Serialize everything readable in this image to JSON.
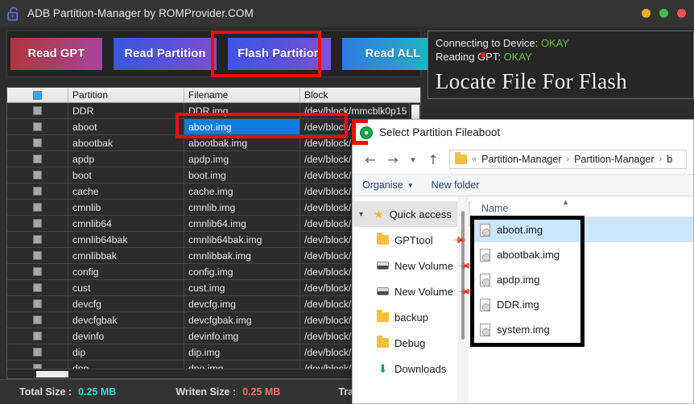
{
  "app": {
    "title": "ADB Partition-Manager by ROMProvider.COM",
    "lock_icon": "unlock-icon",
    "window_controls": [
      {
        "name": "minimize",
        "color": "#eeb020"
      },
      {
        "name": "maximize",
        "color": "#3fbf4e"
      },
      {
        "name": "close",
        "color": "#ef5350"
      }
    ]
  },
  "toolbar": {
    "buttons": [
      {
        "label": "Read GPT",
        "name": "read-gpt-button"
      },
      {
        "label": "Read Partition",
        "name": "read-partition-button"
      },
      {
        "label": "Flash  Partition",
        "name": "flash-partition-button",
        "highlighted": true
      },
      {
        "label": "Read ALL",
        "name": "read-all-button"
      }
    ]
  },
  "table": {
    "headers": [
      "",
      "Partition",
      "Filename",
      "Block"
    ],
    "select_all_checked": true,
    "rows": [
      {
        "partition": "DDR",
        "filename": "DDR.img",
        "block": "/dev/block/mmcblk0p15",
        "selected": false
      },
      {
        "partition": "aboot",
        "filename": "aboot.img",
        "block": "/dev/block/m",
        "selected": true
      },
      {
        "partition": "abootbak",
        "filename": "abootbak.img",
        "block": "/dev/block/m",
        "selected": false
      },
      {
        "partition": "apdp",
        "filename": "apdp.img",
        "block": "/dev/block/m",
        "selected": false
      },
      {
        "partition": "boot",
        "filename": "boot.img",
        "block": "/dev/block/m",
        "selected": false
      },
      {
        "partition": "cache",
        "filename": "cache.img",
        "block": "/dev/block/m",
        "selected": false
      },
      {
        "partition": "cmnlib",
        "filename": "cmnlib.img",
        "block": "/dev/block/m",
        "selected": false
      },
      {
        "partition": "cmnlib64",
        "filename": "cmnlib64.img",
        "block": "/dev/block/m",
        "selected": false
      },
      {
        "partition": "cmnlib64bak",
        "filename": "cmnlib64bak.img",
        "block": "/dev/block/m",
        "selected": false
      },
      {
        "partition": "cmnlibbak",
        "filename": "cmnlibbak.img",
        "block": "/dev/block/m",
        "selected": false
      },
      {
        "partition": "config",
        "filename": "config.img",
        "block": "/dev/block/m",
        "selected": false
      },
      {
        "partition": "cust",
        "filename": "cust.img",
        "block": "/dev/block/m",
        "selected": false
      },
      {
        "partition": "devcfg",
        "filename": "devcfg.img",
        "block": "/dev/block/m",
        "selected": false
      },
      {
        "partition": "devcfgbak",
        "filename": "devcfgbak.img",
        "block": "/dev/block/m",
        "selected": false
      },
      {
        "partition": "devinfo",
        "filename": "devinfo.img",
        "block": "/dev/block/m",
        "selected": false
      },
      {
        "partition": "dip",
        "filename": "dip.img",
        "block": "/dev/block/m",
        "selected": false
      },
      {
        "partition": "dpo",
        "filename": "dpo.img",
        "block": "/dev/block/m",
        "selected": false
      }
    ]
  },
  "status_panel": {
    "line1_label": "Connecting to Device:",
    "line1_value": "OKAY",
    "line2_label": "Reading GPT:",
    "line2_value": "OKAY",
    "heading": "Locate File For Flash"
  },
  "statusbar": {
    "total_size_label": "Total Size :",
    "total_size_value": "0.25 MB",
    "written_size_label": "Writen Size :",
    "written_size_value": "0.25 MB",
    "transfer_label": "Transfe"
  },
  "dialog": {
    "title": "Select Partition Fileaboot",
    "nav": {
      "back_icon": "arrow-left-icon",
      "forward_icon": "arrow-right-icon",
      "recent_icon": "chevron-down-icon",
      "up_icon": "arrow-up-icon"
    },
    "breadcrumb": [
      "«",
      "Partition-Manager",
      "Partition-Manager",
      "b"
    ],
    "commands": [
      {
        "label": "Organise",
        "name": "organise-menu",
        "caret": true
      },
      {
        "label": "New folder",
        "name": "new-folder-button",
        "caret": false
      }
    ],
    "sidebar": [
      {
        "label": "Quick access",
        "icon": "star-icon",
        "selected": true,
        "expander": true,
        "pin": false,
        "indent": false
      },
      {
        "label": "GPTtool",
        "icon": "folder-icon",
        "selected": false,
        "expander": false,
        "pin": true,
        "indent": true
      },
      {
        "label": "New Volume",
        "icon": "drive-icon",
        "selected": false,
        "expander": false,
        "pin": true,
        "indent": true
      },
      {
        "label": "New Volume",
        "icon": "drive-icon",
        "selected": false,
        "expander": false,
        "pin": true,
        "indent": true
      },
      {
        "label": "backup",
        "icon": "folder-icon",
        "selected": false,
        "expander": false,
        "pin": false,
        "indent": true
      },
      {
        "label": "Debug",
        "icon": "folder-icon",
        "selected": false,
        "expander": false,
        "pin": false,
        "indent": true
      },
      {
        "label": "Downloads",
        "icon": "download-icon",
        "selected": false,
        "expander": false,
        "pin": false,
        "indent": true
      }
    ],
    "files_header": "Name",
    "files": [
      {
        "name": "aboot.img",
        "selected": true
      },
      {
        "name": "abootbak.img",
        "selected": false
      },
      {
        "name": "apdp.img",
        "selected": false
      },
      {
        "name": "DDR.img",
        "selected": false
      },
      {
        "name": "system.img",
        "selected": false
      }
    ]
  },
  "colors": {
    "highlight_red": "#f40a0a",
    "highlight_black": "#000000",
    "ok_green": "#63c63f",
    "selection_blue": "#0d7ddd",
    "file_selection": "#cce6fb"
  }
}
